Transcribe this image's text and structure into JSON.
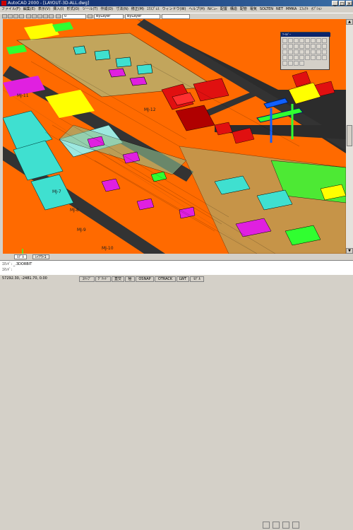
{
  "window": {
    "title": "AutoCAD 2000 - [LAYOUT-3D-ALL.dwg]",
    "controls": [
      "_",
      "□",
      "×"
    ]
  },
  "menu": {
    "items": [
      "ファイル(F)",
      "編集(E)",
      "表示(V)",
      "挿入(I)",
      "形式(O)",
      "ツール(T)",
      "作成(D)",
      "寸法(N)",
      "修正(M)",
      "ｴｸｽﾌﾟﾚｽ",
      "ウィンドウ(W)",
      "ヘルプ(H)",
      "Nﾒﾆｭｰ",
      "配置",
      "構造",
      "配管",
      "電気",
      "SOLTEN",
      "NET",
      "MMKA",
      "ｴﾌｪｸﾄ",
      "ｵﾌﾟｼｮﾝ"
    ]
  },
  "toolbar": {
    "layer_value": "0",
    "color_value": "ByLayer",
    "linetype_value": "ByLayer"
  },
  "float_toolbar": {
    "title": "ﾂｰﾙﾊﾞｰ"
  },
  "drawing": {
    "labels": [
      "MJ-7",
      "MJ-8",
      "MJ-9",
      "MJ-10",
      "MJ-11",
      "MJ-12"
    ]
  },
  "tabs": {
    "items": [
      "ﾓﾃﾞﾙ",
      "ﾚｲｱｳﾄ1"
    ]
  },
  "command": {
    "line1": "ｺﾏﾝﾄﾞ: _.3DORBIT",
    "line2": "ｺﾏﾝﾄﾞ:"
  },
  "status": {
    "coords": "57292.30, -2481.70, 0.00",
    "toggles": [
      "ｽﾅｯﾌﾟ",
      "ｸﾞﾘｯﾄﾞ",
      "直交",
      "極",
      "OSNAP",
      "OTRACK",
      "LWT",
      "ﾓﾃﾞﾙ"
    ]
  },
  "colors": {
    "orange": "#ff6a00",
    "yellow": "#ffff00",
    "cyan": "#3fe0d0",
    "magenta": "#e020e0",
    "green": "#30ff30",
    "red": "#e01010",
    "blue": "#1060ff",
    "road": "#333333"
  }
}
